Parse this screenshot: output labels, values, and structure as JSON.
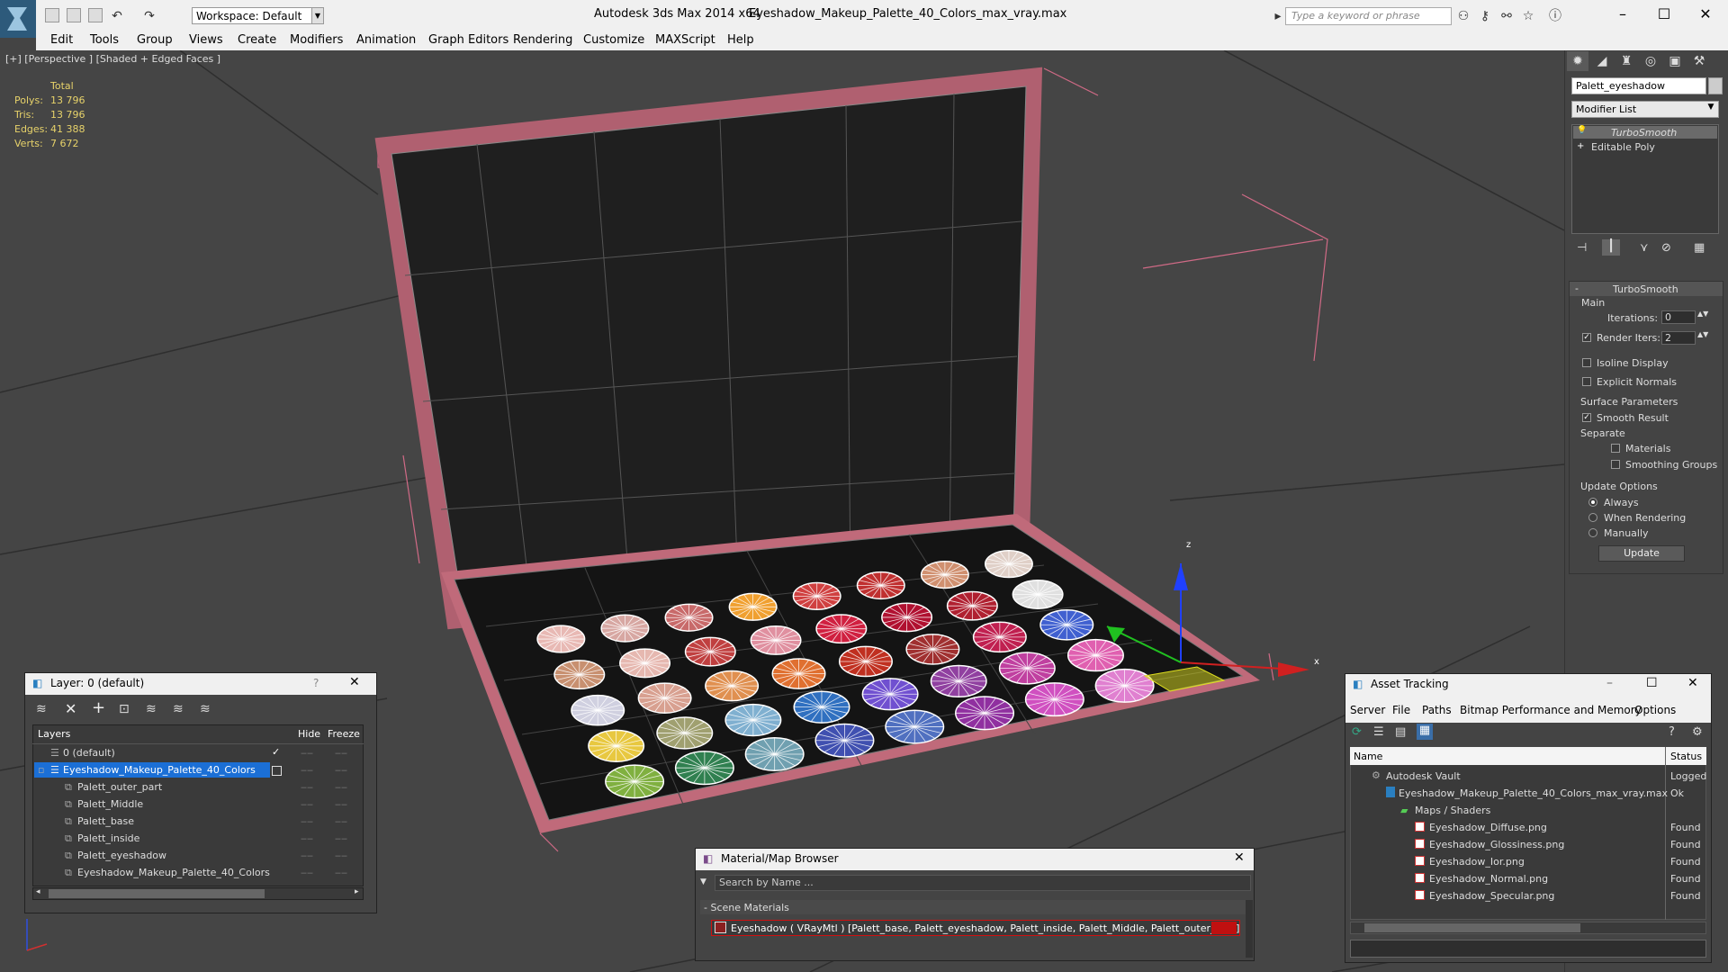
{
  "title": {
    "app": "Autodesk 3ds Max  2014 x64",
    "file": "Eyeshadow_Makeup_Palette_40_Colors_max_vray.max",
    "workspace": "Workspace: Default",
    "search_placeholder": "Type a keyword or phrase"
  },
  "menus": [
    "Edit",
    "Tools",
    "Group",
    "Views",
    "Create",
    "Modifiers",
    "Animation",
    "Graph Editors",
    "Rendering",
    "Customize",
    "MAXScript",
    "Help"
  ],
  "viewport": {
    "label": "[+] [Perspective ] [Shaded + Edged Faces ]",
    "stats": {
      "header": "Total",
      "rows": [
        {
          "label": "Polys:",
          "value": "13 796"
        },
        {
          "label": "Tris:",
          "value": "13 796"
        },
        {
          "label": "Edges:",
          "value": "41 388"
        },
        {
          "label": "Verts:",
          "value": "7 672"
        }
      ]
    },
    "gizmo": {
      "x": "x",
      "z": "z"
    }
  },
  "command_panel": {
    "object_name": "Palett_eyeshadow",
    "modifier_list": "Modifier List",
    "stack": [
      "TurboSmooth",
      "Editable Poly"
    ],
    "turbosmooth": {
      "title": "TurboSmooth",
      "main": "Main",
      "iterations_label": "Iterations:",
      "iterations": "0",
      "render_iters_label": "Render Iters:",
      "render_iters": "2",
      "isoline": "Isoline Display",
      "explicit": "Explicit Normals",
      "surface": "Surface Parameters",
      "smooth_result": "Smooth Result",
      "separate": "Separate",
      "materials": "Materials",
      "smoothing_groups": "Smoothing Groups",
      "update_options": "Update Options",
      "always": "Always",
      "when_rendering": "When Rendering",
      "manually": "Manually",
      "update_button": "Update"
    }
  },
  "layer_window": {
    "title": "Layer: 0 (default)",
    "help": "?",
    "columns": {
      "layers": "Layers",
      "hide": "Hide",
      "freeze": "Freeze"
    },
    "rows": [
      {
        "name": "0 (default)",
        "level": 0,
        "selected": false,
        "check": true
      },
      {
        "name": "Eyeshadow_Makeup_Palette_40_Colors",
        "level": 0,
        "selected": true,
        "check": false
      },
      {
        "name": "Palett_outer_part",
        "level": 1,
        "selected": false,
        "check": false
      },
      {
        "name": "Palett_Middle",
        "level": 1,
        "selected": false,
        "check": false
      },
      {
        "name": "Palett_base",
        "level": 1,
        "selected": false,
        "check": false
      },
      {
        "name": "Palett_inside",
        "level": 1,
        "selected": false,
        "check": false
      },
      {
        "name": "Palett_eyeshadow",
        "level": 1,
        "selected": false,
        "check": false
      },
      {
        "name": "Eyeshadow_Makeup_Palette_40_Colors",
        "level": 1,
        "selected": false,
        "check": false
      }
    ]
  },
  "material_browser": {
    "title": "Material/Map Browser",
    "search_placeholder": "Search by Name ...",
    "section": "- Scene Materials",
    "item": "Eyeshadow  ( VRayMtl )  [Palett_base, Palett_eyeshadow, Palett_inside, Palett_Middle, Palett_outer_part]"
  },
  "asset_tracking": {
    "title": "Asset Tracking",
    "menus": [
      "Server",
      "File",
      "Paths",
      "Bitmap Performance and Memory",
      "Options"
    ],
    "columns": {
      "name": "Name",
      "status": "Status"
    },
    "rows": [
      {
        "name": "Autodesk Vault",
        "status": "Logged",
        "level": 0
      },
      {
        "name": "Eyeshadow_Makeup_Palette_40_Colors_max_vray.max",
        "status": "Ok",
        "level": 1
      },
      {
        "name": "Maps / Shaders",
        "status": "",
        "level": 2
      },
      {
        "name": "Eyeshadow_Diffuse.png",
        "status": "Found",
        "level": 3
      },
      {
        "name": "Eyeshadow_Glossiness.png",
        "status": "Found",
        "level": 3
      },
      {
        "name": "Eyeshadow_Ior.png",
        "status": "Found",
        "level": 3
      },
      {
        "name": "Eyeshadow_Normal.png",
        "status": "Found",
        "level": 3
      },
      {
        "name": "Eyeshadow_Specular.png",
        "status": "Found",
        "level": 3
      }
    ]
  },
  "palette_colors": [
    "#e8b9b4",
    "#d7a7a2",
    "#c86a6a",
    "#f0a030",
    "#d04040",
    "#c03030",
    "#d09070",
    "#e0d0c8",
    "#c89070",
    "#e6b8b0",
    "#c04040",
    "#e090a0",
    "#d02040",
    "#b01030",
    "#b02030",
    "#e0e0e0",
    "#d0d0e0",
    "#d8a090",
    "#e09050",
    "#e07030",
    "#c03020",
    "#a03030",
    "#c02050",
    "#4060d0",
    "#e8c840",
    "#a0a070",
    "#80b0d0",
    "#3070c0",
    "#7050d0",
    "#9040a0",
    "#c040a0",
    "#e060b0",
    "#80b040",
    "#308050",
    "#70a0b0",
    "#4050b0",
    "#5070c0",
    "#9030a0",
    "#d050c0",
    "#e080d0"
  ]
}
